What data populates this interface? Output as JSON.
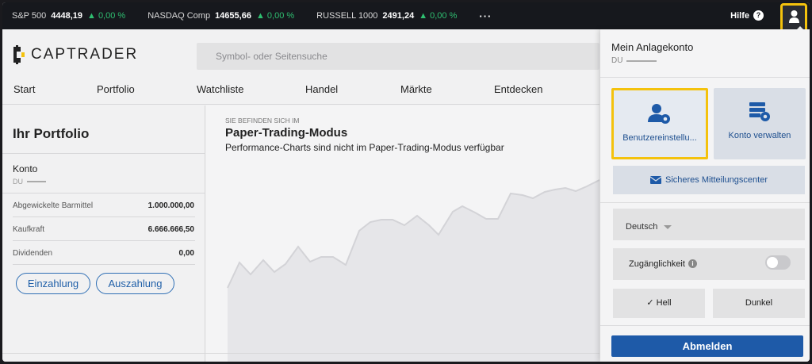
{
  "ticker": {
    "items": [
      {
        "name": "S&P 500",
        "value": "4448,19",
        "change": "▲ 0,00 %"
      },
      {
        "name": "NASDAQ Comp",
        "value": "14655,66",
        "change": "▲ 0,00 %"
      },
      {
        "name": "RUSSELL 1000",
        "value": "2491,24",
        "change": "▲ 0,00 %"
      }
    ],
    "more": "···",
    "help_label": "Hilfe",
    "help_icon": "?"
  },
  "header": {
    "logo_text": "CAPTRADER",
    "search_placeholder": "Symbol- oder Seitensuche"
  },
  "nav": [
    "Start",
    "Portfolio",
    "Watchliste",
    "Handel",
    "Märkte",
    "Entdecken"
  ],
  "portfolio": {
    "title": "Ihr Portfolio",
    "konto_label": "Konto",
    "konto_id": "DU",
    "rows": [
      {
        "label": "Abgewickelte Barmittel",
        "value": "1.000.000,00"
      },
      {
        "label": "Kaufkraft",
        "value": "6.666.666,50"
      },
      {
        "label": "Dividenden",
        "value": "0,00"
      }
    ],
    "deposit_button": "Einzahlung",
    "withdraw_button": "Auszahlung"
  },
  "content": {
    "eyebrow": "SIE BEFINDEN SICH IM",
    "title": "Paper-Trading-Modus",
    "subtitle": "Performance-Charts sind nicht im Paper-Trading-Modus verfügbar"
  },
  "account_menu": {
    "title": "Mein Anlagekonto",
    "account_id": "DU",
    "user_settings": "Benutzereinstellu...",
    "manage_account": "Konto verwalten",
    "message_center": "Sicheres Mitteilungscenter",
    "language": "Deutsch",
    "accessibility": "Zugänglichkeit",
    "accessibility_info": "i",
    "theme_light": "Hell",
    "theme_light_check": "✓",
    "theme_dark": "Dunkel",
    "logout": "Abmelden"
  },
  "colors": {
    "accent": "#1e5aa8",
    "highlight": "#f4c20d",
    "positive": "#2fbf71",
    "ticker_bg": "#16181d"
  }
}
